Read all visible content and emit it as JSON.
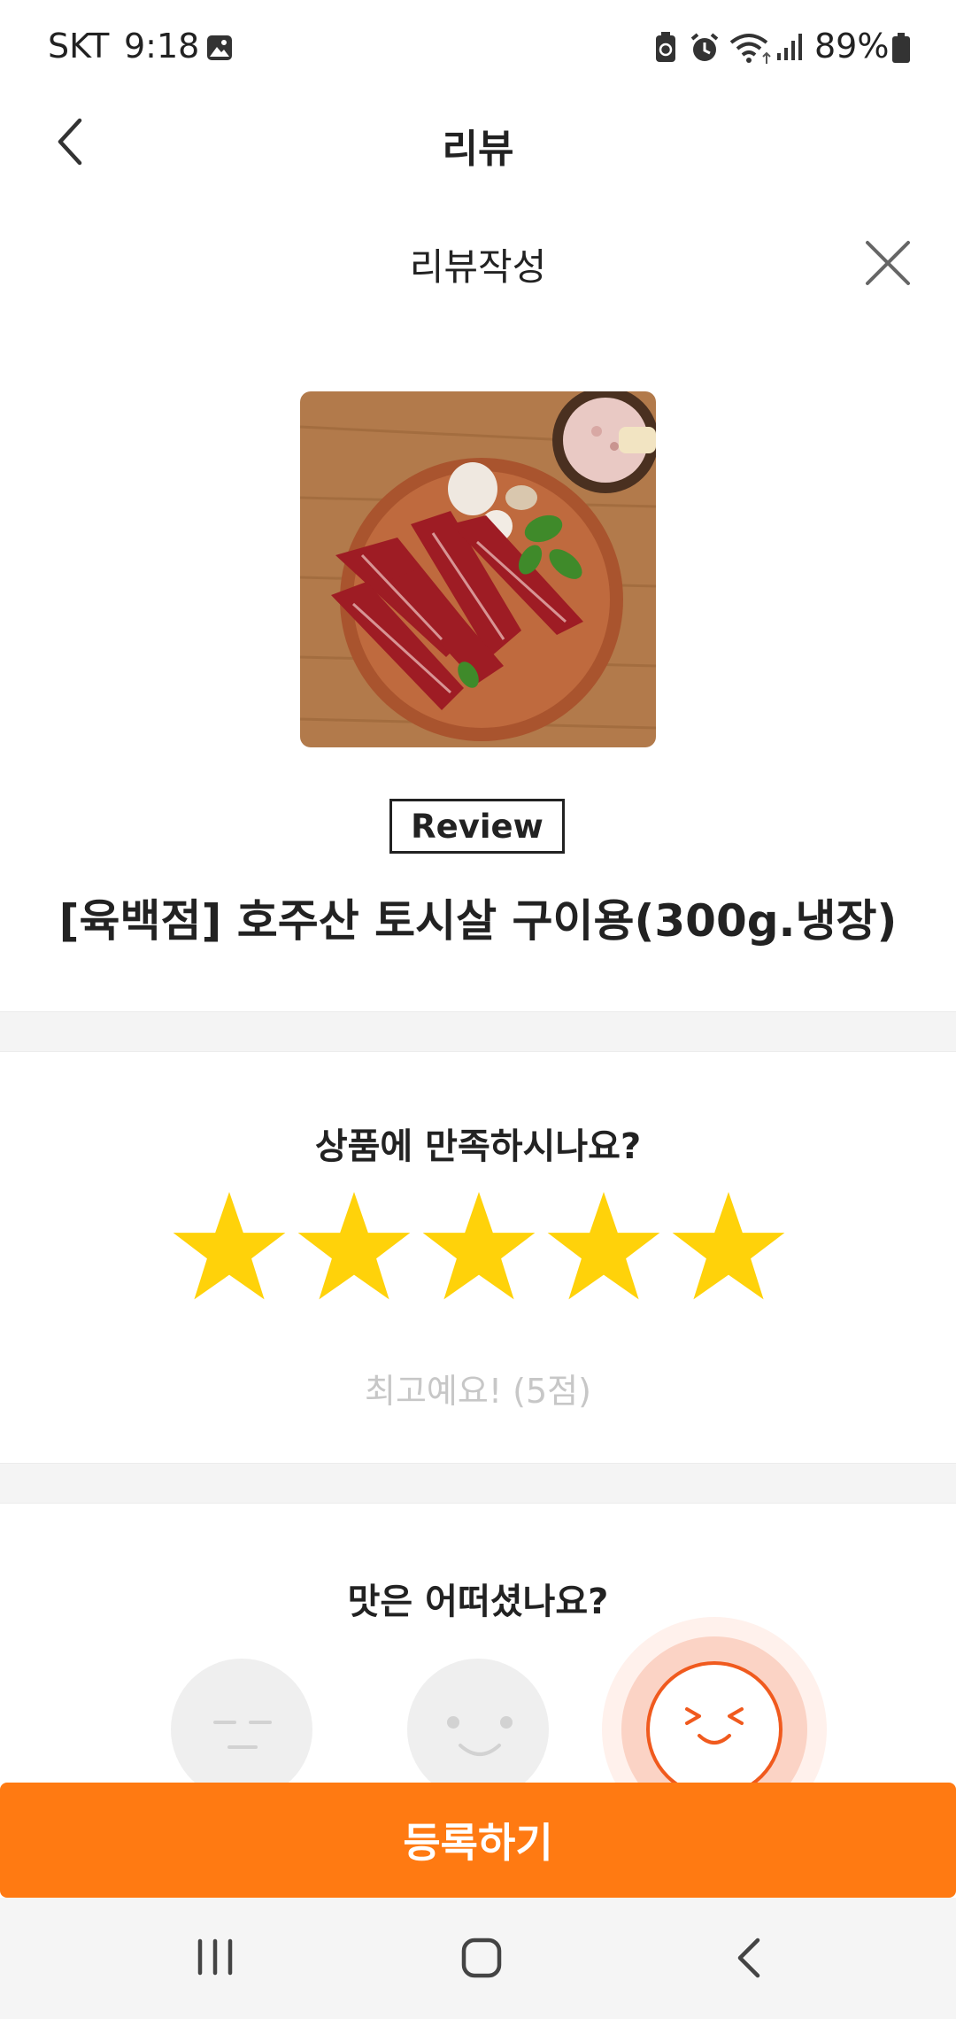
{
  "status_bar": {
    "carrier": "SKT",
    "time": "9:18",
    "battery": "89%"
  },
  "header": {
    "title": "리뷰"
  },
  "sheet": {
    "title": "리뷰작성"
  },
  "product": {
    "badge": "Review",
    "name": "[육백점] 호주산 토시살 구이용(300g.냉장)"
  },
  "rating": {
    "question": "상품에 만족하시나요?",
    "stars_filled": 5,
    "stars_total": 5,
    "result_text": "최고예요! (5점)",
    "star_color": "#FFD20A"
  },
  "taste": {
    "question": "맛은 어떠셨나요?",
    "selected_index": 2,
    "options": [
      "neutral-face-icon",
      "smile-face-icon",
      "delighted-face-icon"
    ]
  },
  "submit": {
    "label": "등록하기",
    "color": "#FF7A12"
  }
}
